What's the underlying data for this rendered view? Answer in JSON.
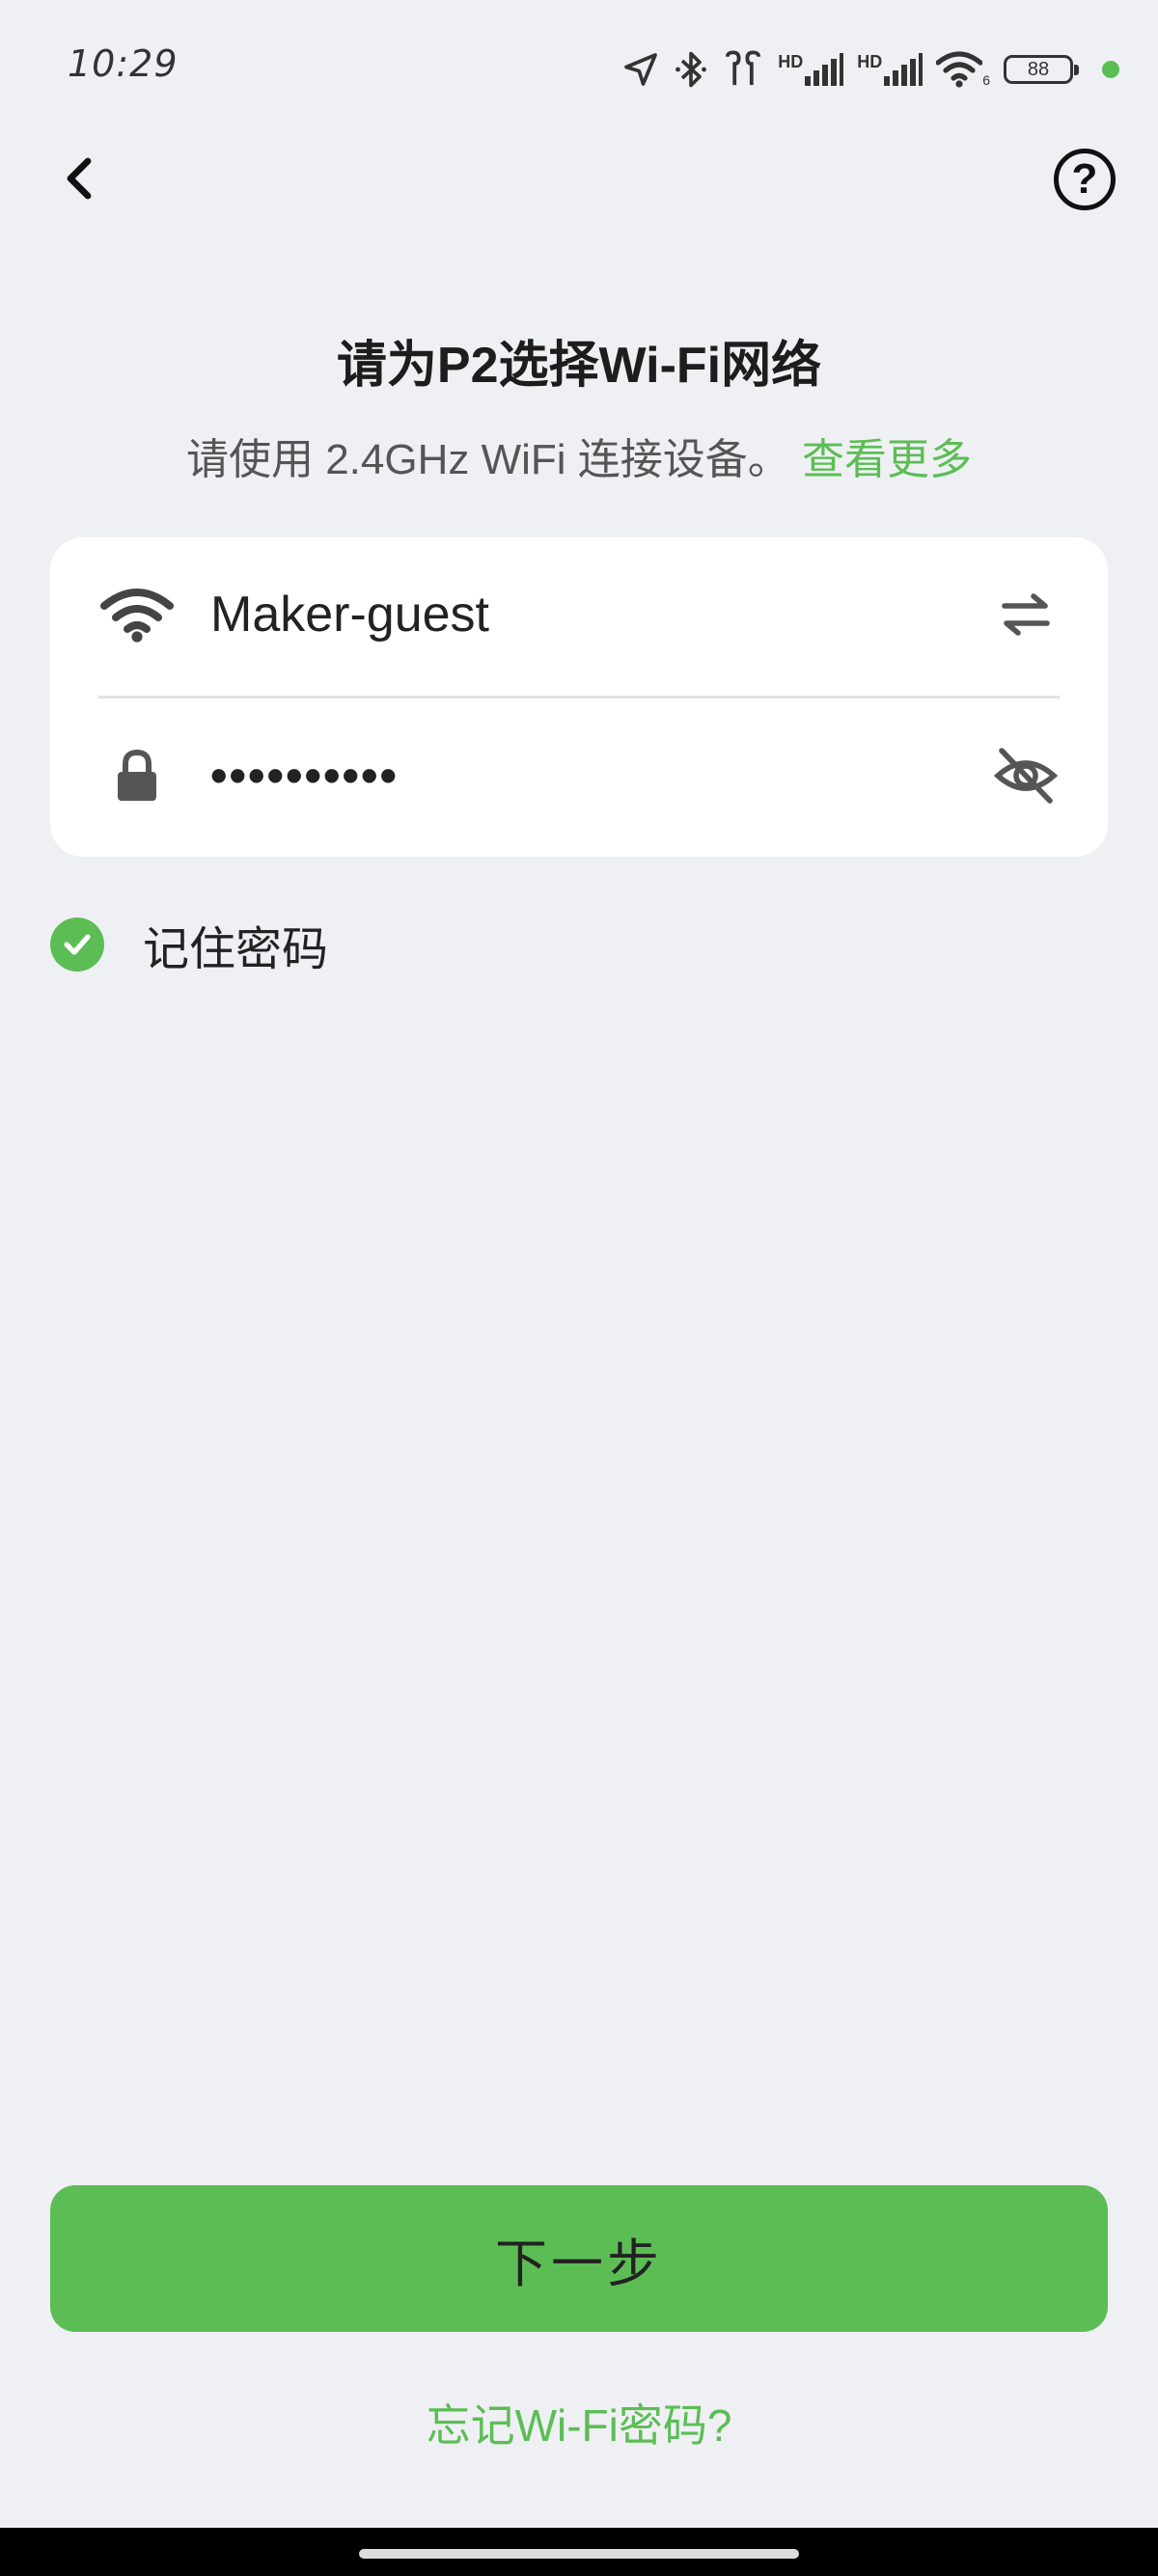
{
  "status_bar": {
    "time": "10:29",
    "hd_label_1": "HD",
    "hd_label_2": "HD",
    "wifi_badge": "6",
    "battery": "88",
    "icons": [
      "location-arrow-icon",
      "bluetooth-icon",
      "earbuds-icon",
      "signal-icon",
      "signal-icon",
      "wifi-icon",
      "battery-icon",
      "dot-indicator"
    ],
    "dot_color": "#5cbd55"
  },
  "nav": {
    "back_icon": "chevron-left-icon",
    "help_icon": "help-icon",
    "help_symbol": "?"
  },
  "header": {
    "title": "请为P2选择Wi-Fi网络",
    "subtitle": "请使用 2.4GHz WiFi 连接设备。",
    "more_link": "查看更多"
  },
  "wifi_form": {
    "ssid": "Maker-guest",
    "password_masked": "••••••••••",
    "wifi_icon": "wifi-icon",
    "switch_icon": "switch-arrows-icon",
    "lock_icon": "lock-icon",
    "visibility_icon": "eye-off-icon"
  },
  "remember": {
    "label": "记住密码",
    "checked": true
  },
  "actions": {
    "next_label": "下一步",
    "forgot_label": "忘记Wi-Fi密码?"
  },
  "colors": {
    "accent": "#5cbd55",
    "background": "#eff0f4",
    "card": "#ffffff"
  }
}
